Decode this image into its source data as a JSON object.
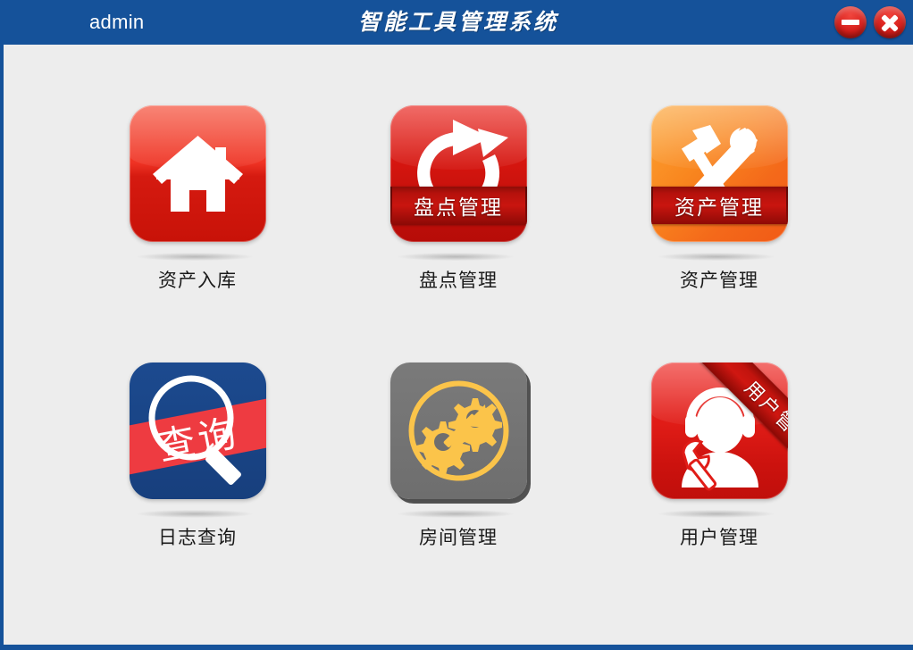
{
  "window": {
    "user_label": "admin",
    "title": "智能工具管理系统",
    "minimize_icon": "minimize-icon",
    "close_icon": "close-icon",
    "title_bar_color": "#15529a",
    "background_color": "#ededed"
  },
  "menu": {
    "items": [
      {
        "label": "资产入库",
        "icon": "home-icon",
        "icon_color": "#ef3324",
        "ribbon": null,
        "ribbon_style": "none"
      },
      {
        "label": "盘点管理",
        "icon": "refresh-arrow-icon",
        "icon_color": "#d4150f",
        "ribbon": "盘点管理",
        "ribbon_style": "horizontal"
      },
      {
        "label": "资产管理",
        "icon": "hammer-wrench-icon",
        "icon_color": "#f9871f",
        "ribbon": "资产管理",
        "ribbon_style": "horizontal"
      },
      {
        "label": "日志查询",
        "icon": "magnifier-search-icon",
        "icon_color": "#1c4a8f",
        "ribbon": "查询",
        "ribbon_style": "diagonal-band"
      },
      {
        "label": "房间管理",
        "icon": "gears-arrow-icon",
        "icon_color": "#6e6e6e",
        "ribbon": null,
        "ribbon_style": "none"
      },
      {
        "label": "用户管理",
        "icon": "user-headset-wrench-icon",
        "icon_color": "#e01c17",
        "ribbon": "用户管理",
        "ribbon_style": "corner"
      }
    ]
  }
}
